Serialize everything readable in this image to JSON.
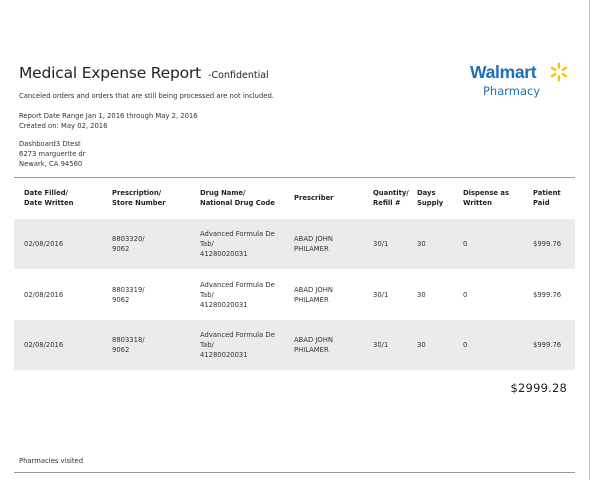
{
  "report": {
    "title": "Medical Expense Report",
    "title_suffix": "-Confidential",
    "note": "Canceled orders and orders that are still being processed are not included.",
    "date_range": "Report Date Range Jan 1, 2016 through May 2, 2016",
    "created_on": "Created on: May 02, 2016"
  },
  "logo": {
    "brand": "Walmart",
    "sub": "Pharmacy",
    "brand_color": "#1f6fb6",
    "spark_color": "#f8c21c",
    "icon": "walmart-spark-icon"
  },
  "customer": {
    "name": "Dashboard3 Dtest",
    "street": "6273 marguerite dr",
    "city": "Newark, CA 94560"
  },
  "table": {
    "headers": [
      [
        "Date Filled/",
        "Date Written"
      ],
      [
        "Prescription/",
        "Store Number"
      ],
      [
        "Drug Name/",
        "National Drug Code"
      ],
      [
        "Prescriber",
        ""
      ],
      [
        "Quantity/",
        "Refill #"
      ],
      [
        "Days",
        "Supply"
      ],
      [
        "Dispense as",
        "Written"
      ],
      [
        "Patient",
        "Paid"
      ]
    ],
    "rows": [
      {
        "date": "02/08/2016",
        "rx": [
          "8803320/",
          "9062"
        ],
        "drug": [
          "Advanced Formula De",
          "Tab/",
          "41280020031"
        ],
        "prescriber": [
          "ABAD JOHN",
          "PHILAMER"
        ],
        "quantity": "30/1",
        "days": "30",
        "daw": "0",
        "paid": "$999.76"
      },
      {
        "date": "02/08/2016",
        "rx": [
          "8803319/",
          "9062"
        ],
        "drug": [
          "Advanced Formula De",
          "Tab/",
          "41280020031"
        ],
        "prescriber": [
          "ABAD JOHN",
          "PHILAMER"
        ],
        "quantity": "30/1",
        "days": "30",
        "daw": "0",
        "paid": "$999.76"
      },
      {
        "date": "02/08/2016",
        "rx": [
          "8803318/",
          "9062"
        ],
        "drug": [
          "Advanced Formula De",
          "Tab/",
          "41280020031"
        ],
        "prescriber": [
          "ABAD JOHN",
          "PHILAMER"
        ],
        "quantity": "30/1",
        "days": "30",
        "daw": "0",
        "paid": "$999.76"
      }
    ],
    "total": "$2999.28"
  },
  "footer": {
    "pharmacies_label": "Pharmacies visited"
  }
}
